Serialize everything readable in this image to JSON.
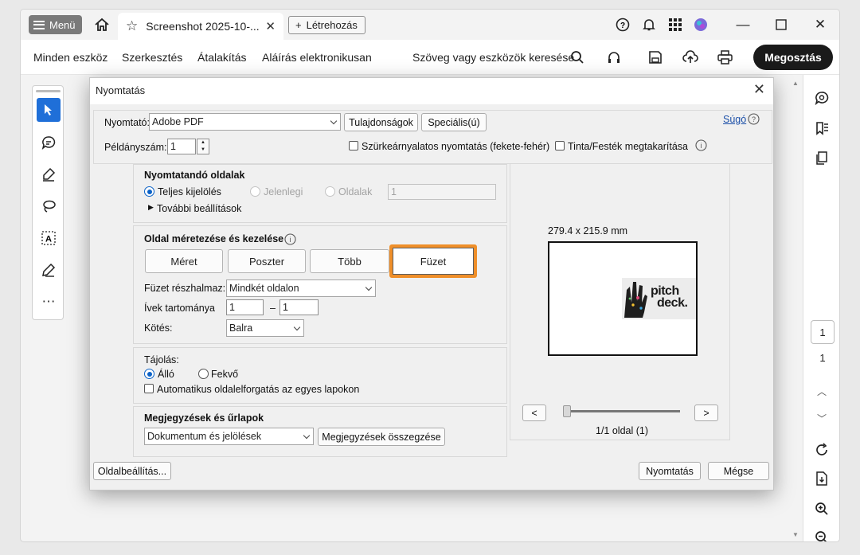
{
  "app": {
    "menu_label": "Menü",
    "tab_title": "Screenshot 2025-10-...",
    "new_label": "Létrehozás",
    "share_label": "Megosztás"
  },
  "toolbar": {
    "items": [
      "Minden eszköz",
      "Szerkesztés",
      "Átalakítás",
      "Aláírás elektronikusan"
    ],
    "search": "Szöveg vagy eszközök keresése"
  },
  "right": {
    "page_input": "1",
    "page_total": "1"
  },
  "dialog": {
    "title": "Nyomtatás",
    "printer_label": "Nyomtató:",
    "printer_value": "Adobe PDF",
    "properties_btn": "Tulajdonságok",
    "advanced_btn": "Speciális(ú)",
    "help_link": "Súgó",
    "copies_label": "Példányszám:",
    "copies_value": "1",
    "grayscale_label": "Szürkeárnyalatos nyomtatás (fekete-fehér)",
    "ink_label": "Tinta/Festék megtakarítása",
    "pages": {
      "heading": "Nyomtatandó oldalak",
      "all": "Teljes kijelölés",
      "current": "Jelenlegi",
      "pages": "Oldalak",
      "pages_value": "1",
      "more": "További beállítások"
    },
    "sizing": {
      "heading": "Oldal méretezése és kezelése",
      "tabs": [
        "Méret",
        "Poszter",
        "Több",
        "Füzet"
      ],
      "active_tab": "Füzet",
      "subset_label": "Füzet részhalmaz:",
      "subset_value": "Mindkét oldalon",
      "sheets_label": "Ívek tartománya",
      "sheets_from": "1",
      "sheets_dash": "–",
      "sheets_to": "1",
      "binding_label": "Kötés:",
      "binding_value": "Balra"
    },
    "orientation": {
      "heading": "Tájolás:",
      "portrait": "Álló",
      "landscape": "Fekvő",
      "autorotate": "Automatikus oldalelforgatás az egyes lapokon"
    },
    "comments": {
      "heading": "Megjegyzések és űrlapok",
      "value": "Dokumentum és jelölések",
      "summary_btn": "Megjegyzések összegzése"
    },
    "preview": {
      "size": "279.4 x 215.9 mm",
      "prev": "<",
      "next": ">",
      "page_info": "1/1 oldal (1)",
      "thumb_text_1": "pitch",
      "thumb_text_2": "deck."
    },
    "page_setup_btn": "Oldalbeállítás...",
    "print_btn": "Nyomtatás",
    "cancel_btn": "Mégse"
  },
  "colors": {
    "accent_orange": "#ef8f2a",
    "radio_blue": "#0b62c7"
  }
}
